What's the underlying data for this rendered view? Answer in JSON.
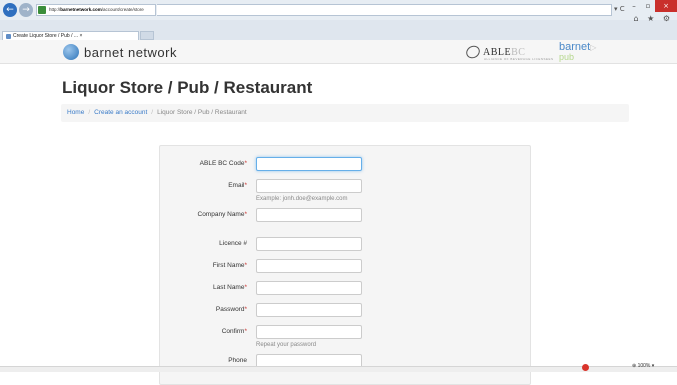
{
  "browser": {
    "url_prefix": "http://",
    "url_domain": "barnetnetwork.com",
    "url_path": "/account/create/store",
    "tab_title": "Create Liquor Store / Pub / ...",
    "tab_close": "×",
    "back_icon": "←",
    "forward_icon": "→",
    "addr_tools": "▾ C",
    "window_buttons": {
      "minimize": "–",
      "maximize": "▫",
      "close": "×"
    },
    "right_icons": "⌂ ★ ⚙"
  },
  "header": {
    "logo_text": "barnet network",
    "able_text_main": "ABLE",
    "able_text_tail": "BC",
    "able_subtitle": "ALLIANCE OF BEVERAGE LICENSEES",
    "pub_logo_top": "barnet",
    "pub_logo_tail": "▷",
    "pub_logo_bottom": "pub"
  },
  "page": {
    "title": "Liquor Store / Pub / Restaurant"
  },
  "breadcrumb": {
    "home": "Home",
    "create": "Create an account",
    "current": "Liquor Store / Pub / Restaurant",
    "separator": "/"
  },
  "form": {
    "required_mark": "*",
    "fields": [
      {
        "label": "ABLE BC Code",
        "required": "*",
        "value": ""
      },
      {
        "label": "Email",
        "required": "*",
        "value": "",
        "help": "Example: jonh.doe@example.com"
      },
      {
        "label": "Company Name",
        "required": "*",
        "value": ""
      },
      {
        "label": "Licence #",
        "required": "",
        "value": ""
      },
      {
        "label": "First Name",
        "required": "*",
        "value": ""
      },
      {
        "label": "Last Name",
        "required": "*",
        "value": ""
      },
      {
        "label": "Password",
        "required": "*",
        "value": ""
      },
      {
        "label": "Confirm",
        "required": "*",
        "value": "",
        "help": "Repeat your password"
      },
      {
        "label": "Phone",
        "required": "",
        "value": ""
      }
    ]
  },
  "statusbar": {
    "zoom": "⊕ 100% ▾"
  },
  "colors": {
    "link": "#3a7bc8",
    "required": "#c9302c",
    "focus": "#66afe9"
  }
}
